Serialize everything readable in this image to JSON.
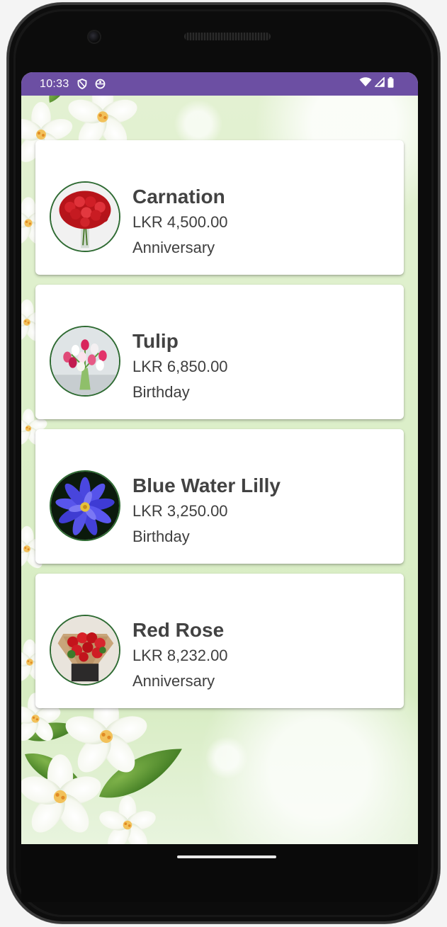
{
  "status_bar": {
    "time": "10:33",
    "left_icons": [
      "vpn-shield-icon",
      "data-saver-icon"
    ],
    "right_icons": [
      "wifi-icon",
      "signal-icon",
      "battery-icon"
    ],
    "color": "#6c4fa3"
  },
  "flowers": [
    {
      "name": "Carnation",
      "price": "LKR 4,500.00",
      "occasion": "Anniversary",
      "image": "red-carnation-bouquet"
    },
    {
      "name": "Tulip",
      "price": "LKR 6,850.00",
      "occasion": "Birthday",
      "image": "mixed-tulip-bouquet"
    },
    {
      "name": "Blue Water Lilly",
      "price": "LKR 3,250.00",
      "occasion": "Birthday",
      "image": "blue-water-lily"
    },
    {
      "name": "Red Rose",
      "price": "LKR 8,232.00",
      "occasion": "Anniversary",
      "image": "red-rose-bouquet"
    }
  ],
  "theme": {
    "accent": "#6c4fa3",
    "thumb_border": "#2f6b33",
    "title_color": "#424242",
    "background": "#e6f2d8"
  }
}
